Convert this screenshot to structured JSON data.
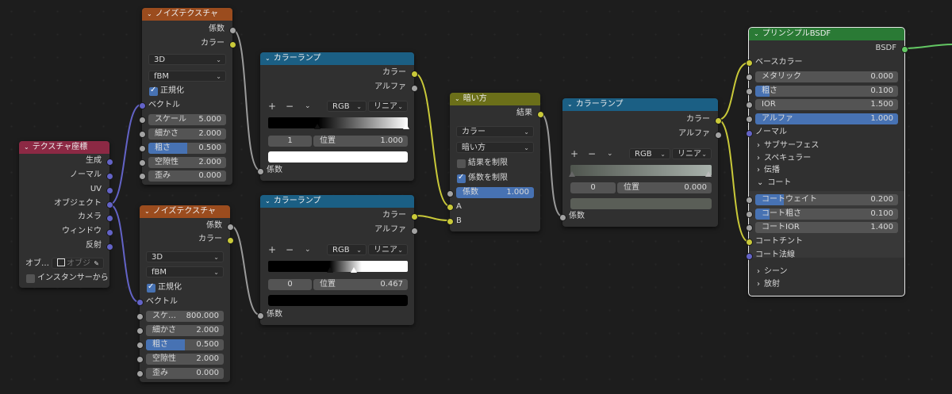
{
  "texcoord": {
    "title": "テクスチャ座標",
    "outputs": [
      "生成",
      "ノーマル",
      "UV",
      "オブジェクト",
      "カメラ",
      "ウィンドウ",
      "反射"
    ],
    "object_label": "オブ…",
    "object_placeholder": "オブジ",
    "from_instancer": "インスタンサーから"
  },
  "noise1": {
    "title": "ノイズテクスチャ",
    "out_fac": "係数",
    "out_color": "カラー",
    "dimensions": "3D",
    "type": "fBM",
    "normalize": "正規化",
    "vector": "ベクトル",
    "scale_label": "スケール",
    "scale": "5.000",
    "detail_label": "細かさ",
    "detail": "2.000",
    "roughness_label": "粗さ",
    "roughness": "0.500",
    "roughness_fraction": 0.5,
    "lacunarity_label": "空隙性",
    "lacunarity": "2.000",
    "distortion_label": "歪み",
    "distortion": "0.000"
  },
  "noise2": {
    "title": "ノイズテクスチャ",
    "out_fac": "係数",
    "out_color": "カラー",
    "dimensions": "3D",
    "type": "fBM",
    "normalize": "正規化",
    "vector": "ベクトル",
    "scale_label": "スケ…",
    "scale": "800.000",
    "detail_label": "細かさ",
    "detail": "2.000",
    "roughness_label": "粗さ",
    "roughness": "0.500",
    "roughness_fraction": 0.5,
    "lacunarity_label": "空隙性",
    "lacunarity": "2.000",
    "distortion_label": "歪み",
    "distortion": "0.000"
  },
  "ramp1": {
    "title": "カラーランプ",
    "out_color": "カラー",
    "out_alpha": "アルファ",
    "color_mode": "RGB",
    "interpolation": "リニア",
    "index": "1",
    "position_label": "位置",
    "position": "1.000",
    "input_fac": "係数",
    "swatch_color": "#ffffff"
  },
  "ramp2": {
    "title": "カラーランプ",
    "out_color": "カラー",
    "out_alpha": "アルファ",
    "color_mode": "RGB",
    "interpolation": "リニア",
    "index": "0",
    "position_label": "位置",
    "position": "0.467",
    "input_fac": "係数",
    "swatch_color": "#000000"
  },
  "darken": {
    "title": "暗い方",
    "out_result": "結果",
    "data_type": "カラー",
    "blend_mode": "暗い方",
    "clamp_result": "結果を制限",
    "clamp_factor": "係数を制限",
    "factor_label": "係数",
    "factor": "1.000",
    "input_a": "A",
    "input_b": "B"
  },
  "ramp3": {
    "title": "カラーランプ",
    "out_color": "カラー",
    "out_alpha": "アルファ",
    "color_mode": "RGB",
    "interpolation": "リニア",
    "index": "0",
    "position_label": "位置",
    "position": "0.000",
    "input_fac": "係数",
    "swatch_color": "#5a5e57"
  },
  "bsdf": {
    "title": "プリンシプルBSDF",
    "out_bsdf": "BSDF",
    "base_color": "ベースカラー",
    "metallic_label": "メタリック",
    "metallic": "0.000",
    "roughness_label": "粗さ",
    "roughness": "0.100",
    "ior_label": "IOR",
    "ior": "1.500",
    "alpha_label": "アルファ",
    "alpha": "1.000",
    "normal": "ノーマル",
    "subsurface": "サブサーフェス",
    "specular": "スペキュラー",
    "transmission": "伝播",
    "coat": "コート",
    "coat_weight_label": "コートウェイト",
    "coat_weight": "0.200",
    "coat_roughness_label": "コート粗さ",
    "coat_roughness": "0.100",
    "coat_ior_label": "コートIOR",
    "coat_ior": "1.400",
    "coat_tint": "コートチント",
    "coat_normal": "コート法線",
    "sheen": "シーン",
    "emission": "放射"
  },
  "colors": {
    "wire_gray": "#9a9a9a",
    "wire_yellow": "#c9c939",
    "wire_purple": "#6363c7",
    "wire_green": "#63c763",
    "accent_blue": "#4772b3"
  }
}
